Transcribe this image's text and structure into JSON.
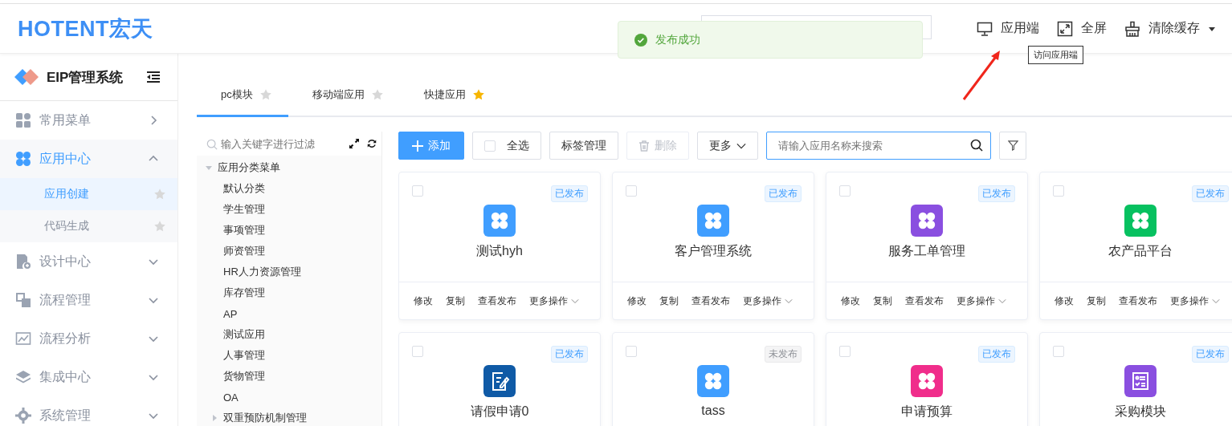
{
  "header": {
    "logo": "HOTENT宏天",
    "actions": [
      {
        "kind": "monitor",
        "label": "应用端"
      },
      {
        "kind": "fullscreen",
        "label": "全屏"
      },
      {
        "kind": "broom",
        "label": "清除缓存",
        "dropdown": true
      }
    ],
    "tooltip": "访问应用端",
    "toast": {
      "text": "发布成功"
    }
  },
  "sidebar": {
    "title": "EIP管理系统",
    "items": [
      {
        "kind": "link",
        "label": "常用菜单",
        "expanded": false
      },
      {
        "kind": "group",
        "label": "应用中心",
        "expanded": true,
        "children": [
          {
            "label": "应用创建",
            "selected": true
          },
          {
            "label": "代码生成",
            "selected": false
          }
        ]
      },
      {
        "kind": "group",
        "label": "设计中心",
        "expanded": false
      },
      {
        "kind": "group",
        "label": "流程管理",
        "expanded": false
      },
      {
        "kind": "group",
        "label": "流程分析",
        "expanded": false
      },
      {
        "kind": "group",
        "label": "集成中心",
        "expanded": false
      },
      {
        "kind": "group",
        "label": "系统管理",
        "expanded": false
      }
    ]
  },
  "tabs": [
    {
      "label": "pc模块",
      "selected": true,
      "starred": false
    },
    {
      "label": "移动端应用",
      "selected": false,
      "starred": false
    },
    {
      "label": "快捷应用",
      "selected": false,
      "starred": true
    }
  ],
  "tree": {
    "placeholder": "输入关键字进行过滤",
    "nodes": [
      {
        "label": "应用分类菜单",
        "expanded": true,
        "children": [
          {
            "label": "默认分类"
          },
          {
            "label": "学生管理"
          },
          {
            "label": "事项管理"
          },
          {
            "label": "师资管理"
          },
          {
            "label": "HR人力资源管理"
          },
          {
            "label": "库存管理"
          },
          {
            "label": "AP"
          },
          {
            "label": "测试应用"
          },
          {
            "label": "人事管理"
          },
          {
            "label": "货物管理"
          },
          {
            "label": "OA"
          },
          {
            "label": "双重预防机制管理",
            "expanded": false
          }
        ]
      }
    ]
  },
  "toolbar": {
    "add": "添加",
    "select_all": {
      "label": "全选",
      "checked": false
    },
    "tags": "标签管理",
    "delete": {
      "label": "删除",
      "disabled": true
    },
    "more": "更多",
    "search": {
      "placeholder": "请输入应用名称来搜索"
    }
  },
  "cards": [
    {
      "name": "测试hyh",
      "status": "已发布",
      "published": true,
      "kind": "clover",
      "color": "#409eff",
      "checked": false,
      "actions": [
        "修改",
        "复制",
        "查看发布",
        "更多操作"
      ]
    },
    {
      "name": "客户管理系统",
      "status": "已发布",
      "published": true,
      "kind": "clover",
      "color": "#409eff",
      "checked": false,
      "actions": [
        "修改",
        "复制",
        "查看发布",
        "更多操作"
      ]
    },
    {
      "name": "服务工单管理",
      "status": "已发布",
      "published": true,
      "kind": "clover",
      "color": "#8a4fe0",
      "checked": false,
      "actions": [
        "修改",
        "复制",
        "查看发布",
        "更多操作"
      ]
    },
    {
      "name": "农产品平台",
      "status": "已发布",
      "published": true,
      "kind": "clover",
      "color": "#07c160",
      "checked": false,
      "actions": [
        "修改",
        "复制",
        "查看发布",
        "更多操作"
      ]
    },
    {
      "name": "请假申请0",
      "status": "已发布",
      "published": true,
      "kind": "edit",
      "color": "#0f5aa6",
      "checked": false
    },
    {
      "name": "tass",
      "status": "未发布",
      "published": false,
      "kind": "clover",
      "color": "#409eff",
      "checked": false
    },
    {
      "name": "申请预算",
      "status": "已发布",
      "published": true,
      "kind": "clover",
      "color": "#f02d8b",
      "checked": false
    },
    {
      "name": "采购模块",
      "status": "已发布",
      "published": true,
      "kind": "form",
      "color": "#8a4fe0",
      "checked": false
    }
  ]
}
